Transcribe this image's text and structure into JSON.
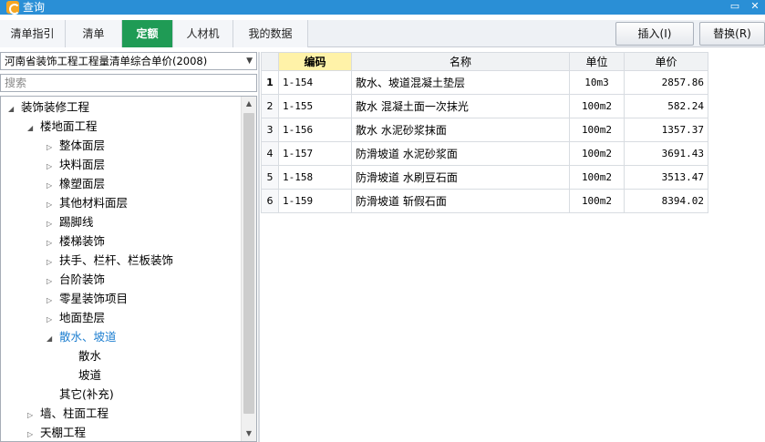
{
  "window": {
    "title": "查询",
    "minimize": "▭",
    "close": "✕"
  },
  "tabs": [
    {
      "label": "清单指引",
      "active": false
    },
    {
      "label": "清单",
      "active": false
    },
    {
      "label": "定额",
      "active": true
    },
    {
      "label": "人材机",
      "active": false
    },
    {
      "label": "我的数据",
      "active": false
    }
  ],
  "toolbar": {
    "insert_label": "插入(I)",
    "replace_label": "替换(R)"
  },
  "left": {
    "library": "河南省装饰工程工程量清单综合单价(2008)",
    "search_placeholder": "搜索",
    "tree": [
      {
        "label": "装饰装修工程",
        "level": 0,
        "toggle": "◢"
      },
      {
        "label": "楼地面工程",
        "level": 1,
        "toggle": "◢"
      },
      {
        "label": "整体面层",
        "level": 2,
        "toggle": "▷"
      },
      {
        "label": "块料面层",
        "level": 2,
        "toggle": "▷"
      },
      {
        "label": "橡塑面层",
        "level": 2,
        "toggle": "▷"
      },
      {
        "label": "其他材料面层",
        "level": 2,
        "toggle": "▷"
      },
      {
        "label": "踢脚线",
        "level": 2,
        "toggle": "▷"
      },
      {
        "label": "楼梯装饰",
        "level": 2,
        "toggle": "▷"
      },
      {
        "label": "扶手、栏杆、栏板装饰",
        "level": 2,
        "toggle": "▷"
      },
      {
        "label": "台阶装饰",
        "level": 2,
        "toggle": "▷"
      },
      {
        "label": "零星装饰项目",
        "level": 2,
        "toggle": "▷"
      },
      {
        "label": "地面垫层",
        "level": 2,
        "toggle": "▷"
      },
      {
        "label": "散水、坡道",
        "level": 2,
        "toggle": "◢",
        "selected": true
      },
      {
        "label": "散水",
        "level": 3,
        "toggle": ""
      },
      {
        "label": "坡道",
        "level": 3,
        "toggle": ""
      },
      {
        "label": "其它(补充)",
        "level": 2,
        "toggle": ""
      },
      {
        "label": "墙、柱面工程",
        "level": 1,
        "toggle": "▷"
      },
      {
        "label": "天棚工程",
        "level": 1,
        "toggle": "▷"
      }
    ]
  },
  "grid": {
    "columns": [
      "编码",
      "名称",
      "单位",
      "单价"
    ],
    "rows": [
      {
        "n": "1",
        "code": "1-154",
        "name": "散水、坡道混凝土垫层",
        "unit": "10m3",
        "price": "2857.86"
      },
      {
        "n": "2",
        "code": "1-155",
        "name": "散水 混凝土面一次抹光",
        "unit": "100m2",
        "price": "582.24"
      },
      {
        "n": "3",
        "code": "1-156",
        "name": "散水 水泥砂浆抹面",
        "unit": "100m2",
        "price": "1357.37"
      },
      {
        "n": "4",
        "code": "1-157",
        "name": "防滑坡道 水泥砂浆面",
        "unit": "100m2",
        "price": "3691.43"
      },
      {
        "n": "5",
        "code": "1-158",
        "name": "防滑坡道 水刷豆石面",
        "unit": "100m2",
        "price": "3513.47"
      },
      {
        "n": "6",
        "code": "1-159",
        "name": "防滑坡道 斩假石面",
        "unit": "100m2",
        "price": "8394.02"
      }
    ]
  },
  "colors": {
    "titlebar": "#2a8fd6",
    "active_tab": "#1f9b55",
    "selected_tree": "#1e7fd0",
    "header_highlight": "#fff2a8"
  }
}
